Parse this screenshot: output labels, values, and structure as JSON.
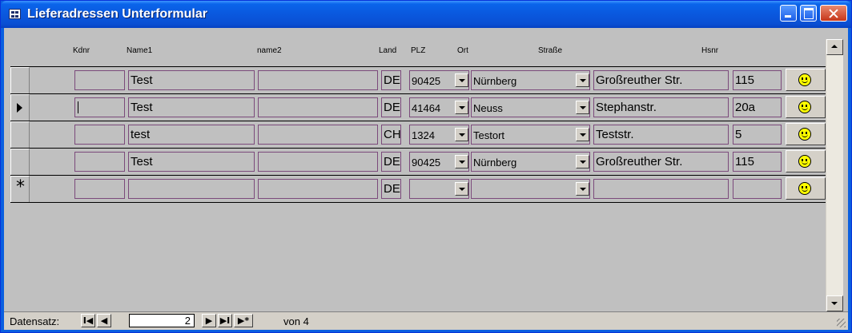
{
  "window": {
    "title": "Lieferadressen Unterformular"
  },
  "columns": {
    "kdnr": "Kdnr",
    "name1": "Name1",
    "name2": "name2",
    "land": "Land",
    "plz": "PLZ",
    "ort": "Ort",
    "strasse": "Straße",
    "hsnr": "Hsnr"
  },
  "rows": [
    {
      "kdnr": "",
      "name1": "Test",
      "name2": "",
      "land": "DE",
      "plz": "90425",
      "ort": "Nürnberg",
      "strasse": "Großreuther Str.",
      "hsnr": "115",
      "selector": ""
    },
    {
      "kdnr": "",
      "name1": "Test",
      "name2": "",
      "land": "DE",
      "plz": "41464",
      "ort": "Neuss",
      "strasse": "Stephanstr.",
      "hsnr": "20a",
      "selector": "current"
    },
    {
      "kdnr": "",
      "name1": "test",
      "name2": "",
      "land": "CH",
      "plz": "1324",
      "ort": "Testort",
      "strasse": "Teststr.",
      "hsnr": "5",
      "selector": ""
    },
    {
      "kdnr": "",
      "name1": "Test",
      "name2": "",
      "land": "DE",
      "plz": "90425",
      "ort": "Nürnberg",
      "strasse": "Großreuther Str.",
      "hsnr": "115",
      "selector": ""
    },
    {
      "kdnr": "",
      "name1": "",
      "name2": "",
      "land": "DE",
      "plz": "",
      "ort": "",
      "strasse": "",
      "hsnr": "",
      "selector": "new"
    }
  ],
  "navigation": {
    "label": "Datensatz:",
    "first": "I◀",
    "prev": "◀",
    "current_record": "2",
    "next": "▶",
    "last": "▶I",
    "new": "▶*",
    "of_text": "von 4"
  },
  "colors": {
    "titlebar": "#0a58de",
    "field_border": "#7b4a7b",
    "smiley": "#ffff00"
  }
}
